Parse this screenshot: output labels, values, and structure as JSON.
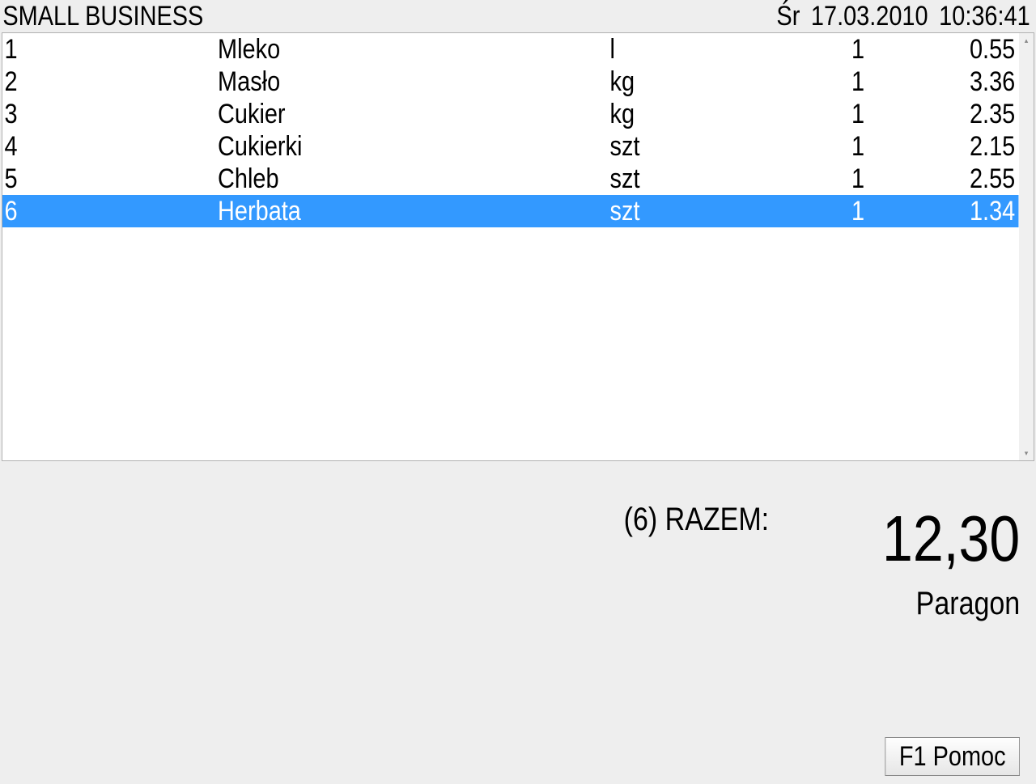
{
  "header": {
    "title": "SMALL BUSINESS",
    "day": "Śr",
    "date": "17.03.2010",
    "time": "10:36:41"
  },
  "items": [
    {
      "num": "1",
      "name": "Mleko",
      "unit": "l",
      "qty": "1",
      "price": "0.55",
      "selected": false
    },
    {
      "num": "2",
      "name": "Masło",
      "unit": "kg",
      "qty": "1",
      "price": "3.36",
      "selected": false
    },
    {
      "num": "3",
      "name": "Cukier",
      "unit": "kg",
      "qty": "1",
      "price": "2.35",
      "selected": false
    },
    {
      "num": "4",
      "name": "Cukierki",
      "unit": "szt",
      "qty": "1",
      "price": "2.15",
      "selected": false
    },
    {
      "num": "5",
      "name": "Chleb",
      "unit": "szt",
      "qty": "1",
      "price": "2.55",
      "selected": false
    },
    {
      "num": "6",
      "name": "Herbata",
      "unit": "szt",
      "qty": "1",
      "price": "1.34",
      "selected": true
    }
  ],
  "summary": {
    "count_label_prefix": "(6)",
    "razem_label": "RAZEM:",
    "total": "12,30",
    "doc_type": "Paragon"
  },
  "help_button": "F1 Pomoc"
}
